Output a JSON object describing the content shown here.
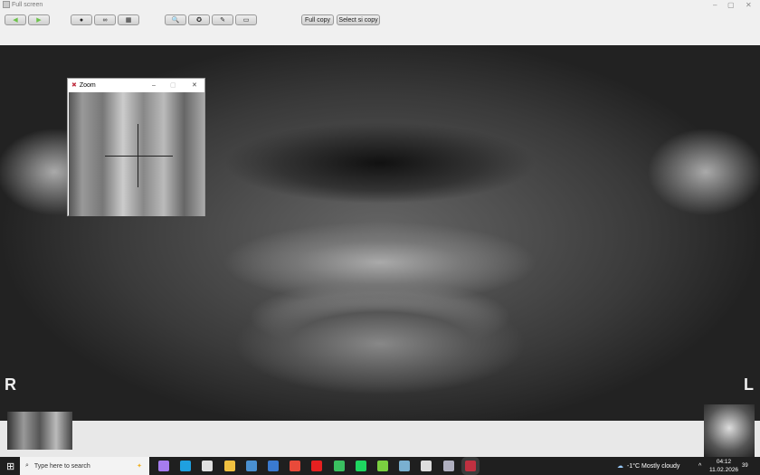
{
  "window": {
    "title": "Full screen",
    "controls": [
      "–",
      "▢",
      "✕"
    ]
  },
  "toolbar": {
    "buttons": [
      {
        "name": "back-button",
        "icon": "arrow-left-icon",
        "color": "#6cc24a"
      },
      {
        "name": "forward-button",
        "icon": "arrow-right-icon",
        "color": "#6cc24a"
      },
      {
        "name": "circle-tool-button",
        "icon": "circle-icon",
        "glyph": "●"
      },
      {
        "name": "infinity-tool-button",
        "icon": "infinity-icon",
        "glyph": "∞"
      },
      {
        "name": "grid-view-button",
        "icon": "grid-icon",
        "glyph": "▦"
      },
      {
        "name": "zoom-tool-button",
        "icon": "magnifier-icon",
        "glyph": "🔍"
      },
      {
        "name": "lifebuoy-button",
        "icon": "lifebuoy-icon",
        "glyph": "✪"
      },
      {
        "name": "pencil-button",
        "icon": "pencil-icon",
        "glyph": "✎"
      },
      {
        "name": "monitor-button",
        "icon": "monitor-icon",
        "glyph": "▭"
      }
    ],
    "full_copy": "Full copy",
    "select_copy": "Select si copy"
  },
  "image": {
    "left_marker": "R",
    "right_marker": "L"
  },
  "zoom_window": {
    "title": "Zoom",
    "min": "–",
    "max": "▢",
    "close": "✕"
  },
  "taskbar": {
    "search_placeholder": "Type here to search",
    "weather": "-1°C  Mostly cloudy",
    "time": "04:12",
    "date": "11.02.2026",
    "notifications": "39",
    "apps": [
      {
        "name": "copilot",
        "color": "#a67cf0"
      },
      {
        "name": "edge",
        "color": "#1fa0e0"
      },
      {
        "name": "store",
        "color": "#e0e0e0"
      },
      {
        "name": "file-explorer",
        "color": "#f0c040"
      },
      {
        "name": "media",
        "color": "#4a90d0"
      },
      {
        "name": "app",
        "color": "#3a7ad0"
      },
      {
        "name": "chrome",
        "color": "#e84a3a"
      },
      {
        "name": "youtube",
        "color": "#e62020"
      },
      {
        "name": "whatsapp",
        "color": "#3ac060"
      },
      {
        "name": "spotify",
        "color": "#1ed760"
      },
      {
        "name": "music",
        "color": "#7ad040"
      },
      {
        "name": "network",
        "color": "#7ab0d0"
      },
      {
        "name": "document",
        "color": "#ddd"
      },
      {
        "name": "paint",
        "color": "#b0b0c0"
      },
      {
        "name": "xray-viewer",
        "color": "#c03040"
      }
    ]
  }
}
